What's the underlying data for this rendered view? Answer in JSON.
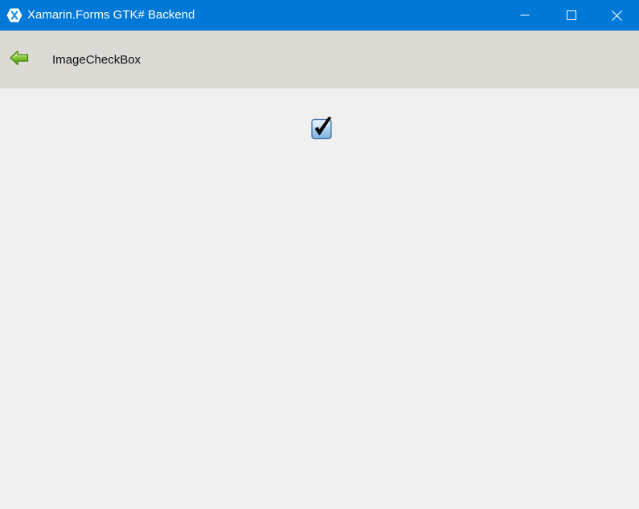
{
  "window": {
    "title": "Xamarin.Forms GTK# Backend",
    "icon": "xamarin-icon",
    "controls": {
      "minimize_icon": "minimize-icon",
      "maximize_icon": "maximize-icon",
      "close_icon": "close-icon"
    },
    "accent_color": "#0078d7"
  },
  "navbar": {
    "back_icon": "green-back-arrow-icon",
    "title": "ImageCheckBox",
    "background_color": "#dcdad5"
  },
  "content": {
    "checkbox": {
      "checked": true,
      "icon": "checked-checkbox-icon"
    },
    "background_color": "#f0f0f0"
  }
}
